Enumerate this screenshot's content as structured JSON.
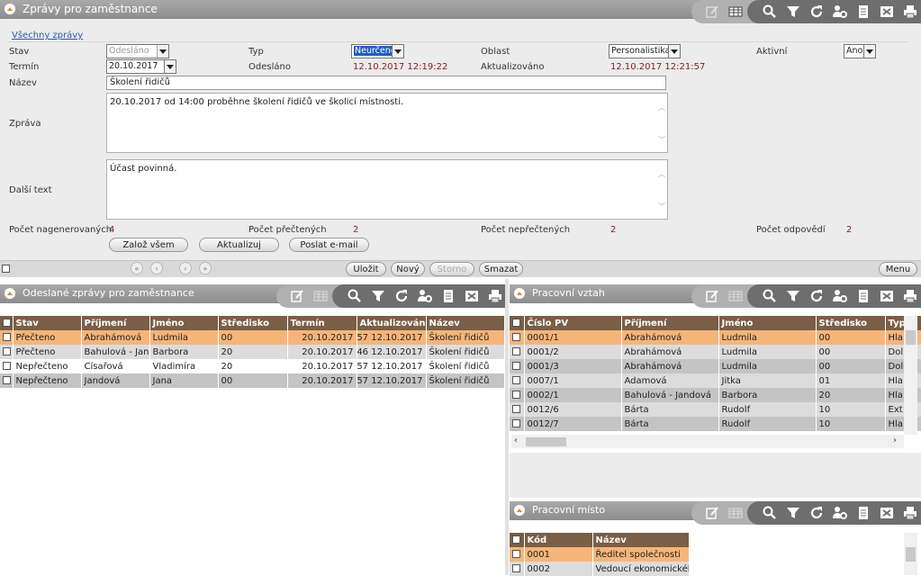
{
  "main": {
    "title": "Zprávy pro zaměstnance",
    "link_all": "Všechny zprávy",
    "labels": {
      "stav": "Stav",
      "typ": "Typ",
      "oblast": "Oblast",
      "aktivni": "Aktivní",
      "termin": "Termín",
      "odeslano": "Odesláno",
      "aktualizovano": "Aktualizováno",
      "nazev": "Název",
      "zprava": "Zpráva",
      "dalsi_text": "Další text",
      "pocet_nagenerovanych": "Počet nagenerovaných",
      "pocet_prectenych": "Počet přečtených",
      "pocet_neprectenych": "Počet nepřečtených",
      "pocet_odpovedi": "Počet odpovědí"
    },
    "values": {
      "stav": "Odesláno",
      "typ": "Neurčeno",
      "oblast": "Personalistika",
      "aktivni": "Ano",
      "termin": "20.10.2017",
      "odeslano": "12.10.2017 12:19:22",
      "aktualizovano": "12.10.2017 12:21:57",
      "nazev": "Školení řidičů",
      "zprava": "20.10.2017 od 14:00 proběhne školení řidičů ve školicí místnosti.",
      "dalsi_text": "Účast povinná.",
      "pocet_nagenerovanych": "4",
      "pocet_prectenych": "2",
      "pocet_neprectenych": "2",
      "pocet_odpovedi": "2"
    },
    "buttons": {
      "zaloz_vsem": "Založ všem",
      "aktualizuj": "Aktualizuj",
      "poslat_email": "Poslat e-mail"
    },
    "bottom_buttons": {
      "ulozit": "Uložit",
      "novy": "Nový",
      "storno": "Storno",
      "smazat": "Smazat",
      "menu": "Menu"
    }
  },
  "sent": {
    "title": "Odeslané zprávy pro zaměstnance",
    "columns": [
      "Stav",
      "Příjmení",
      "Jméno",
      "Středisko",
      "Termín",
      "Aktualizován",
      "Název"
    ],
    "rows": [
      [
        "Přečteno",
        "Abrahámová",
        "Ludmila",
        "00",
        "20.10.2017",
        "12.10.2017 12:21:57",
        "Školení řidičů"
      ],
      [
        "Přečteno",
        "Bahulová - Jandová",
        "Barbora",
        "20",
        "20.10.2017",
        "12.10.2017 12:55:46",
        "Školení řidičů"
      ],
      [
        "Nepřečteno",
        "Císařová",
        "Vladimíra",
        "20",
        "20.10.2017",
        "12.10.2017 12:21:57",
        "Školení řidičů"
      ],
      [
        "Nepřečteno",
        "Jandová",
        "Jana",
        "00",
        "20.10.2017",
        "12.10.2017 12:21:57",
        "Školení řidičů"
      ]
    ]
  },
  "pv": {
    "title": "Pracovní vztah",
    "columns": [
      "Číslo PV",
      "Příjmení",
      "Jméno",
      "Středisko",
      "Typ"
    ],
    "rows": [
      [
        "0001/1",
        "Abrahámová",
        "Ludmila",
        "00",
        "Hla"
      ],
      [
        "0001/2",
        "Abrahámová",
        "Ludmila",
        "00",
        "Dol"
      ],
      [
        "0001/3",
        "Abrahámová",
        "Ludmila",
        "00",
        "Dol"
      ],
      [
        "0007/1",
        "Adamová",
        "Jitka",
        "01",
        "Hla"
      ],
      [
        "0002/1",
        "Bahulová - Jandová",
        "Barbora",
        "20",
        "Hla"
      ],
      [
        "0012/6",
        "Bárta",
        "Rudolf",
        "10",
        "Ext"
      ],
      [
        "0012/7",
        "Bárta",
        "Rudolf",
        "10",
        "Hla"
      ]
    ]
  },
  "pm": {
    "title": "Pracovní místo",
    "columns": [
      "Kód",
      "Název"
    ],
    "rows": [
      [
        "0001",
        "Ředitel společnosti"
      ],
      [
        "0002",
        "Vedoucí ekonomického"
      ]
    ]
  },
  "colors": {
    "header_brown": "#7a5e45",
    "selected_row": "#f5b57a",
    "value_red": "#8b1a1a"
  }
}
